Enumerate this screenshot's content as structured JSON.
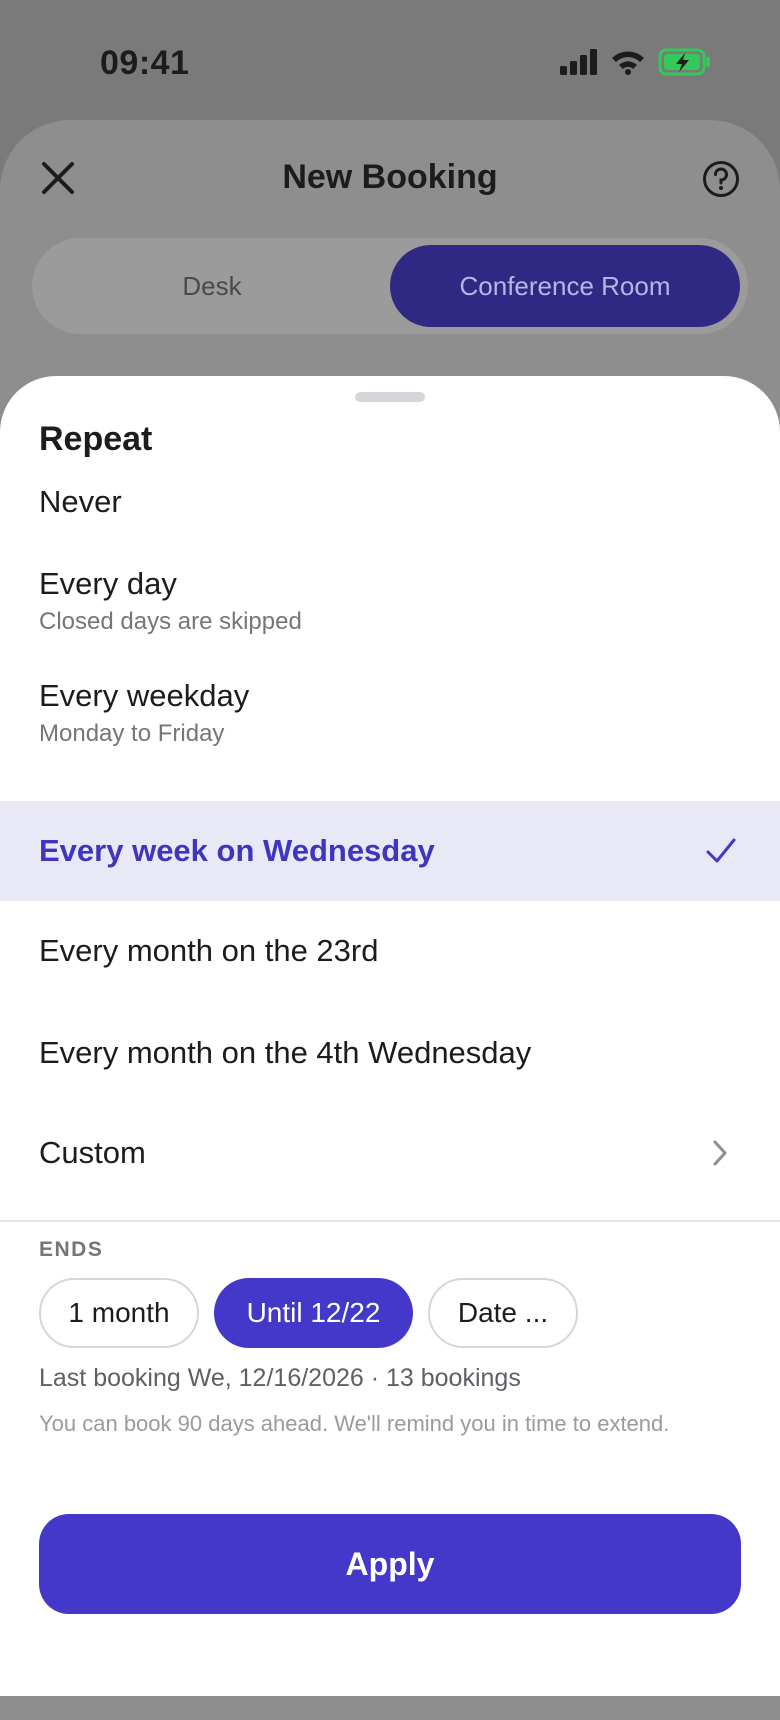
{
  "status_bar": {
    "time": "09:41",
    "icons": [
      "signal-icon",
      "wifi-icon",
      "battery-charging-icon"
    ]
  },
  "header": {
    "title": "New Booking",
    "close_icon": "close-icon",
    "help_icon": "help-icon"
  },
  "segmented": {
    "options": [
      "Desk",
      "Conference Room"
    ],
    "selected": "Conference Room"
  },
  "sheet": {
    "title": "Repeat",
    "options": [
      {
        "label": "Never",
        "sub": ""
      },
      {
        "label": "Every day",
        "sub": "Closed days are skipped"
      },
      {
        "label": "Every weekday",
        "sub": "Monday to Friday"
      },
      {
        "label": "Every week on Wednesday",
        "sub": "",
        "selected": true
      },
      {
        "label": "Every month on the 23rd",
        "sub": ""
      },
      {
        "label": "Every month on the 4th Wednesday",
        "sub": ""
      },
      {
        "label": "Custom",
        "sub": ""
      }
    ],
    "ends": {
      "label": "ENDS",
      "chips": [
        "1 month",
        "Until 12/22",
        "Date ..."
      ],
      "selected": "Until 12/22"
    },
    "last_booking": "Last booking We, 12/16/2026 · 13 bookings",
    "hint": "You can book 90 days ahead. We'll remind you in time to extend.",
    "apply_label": "Apply"
  },
  "colors": {
    "accent": "#4338ca",
    "accent_dark": "#2f2984",
    "selected_bg": "#e9e8f6",
    "battery": "#34c759"
  }
}
